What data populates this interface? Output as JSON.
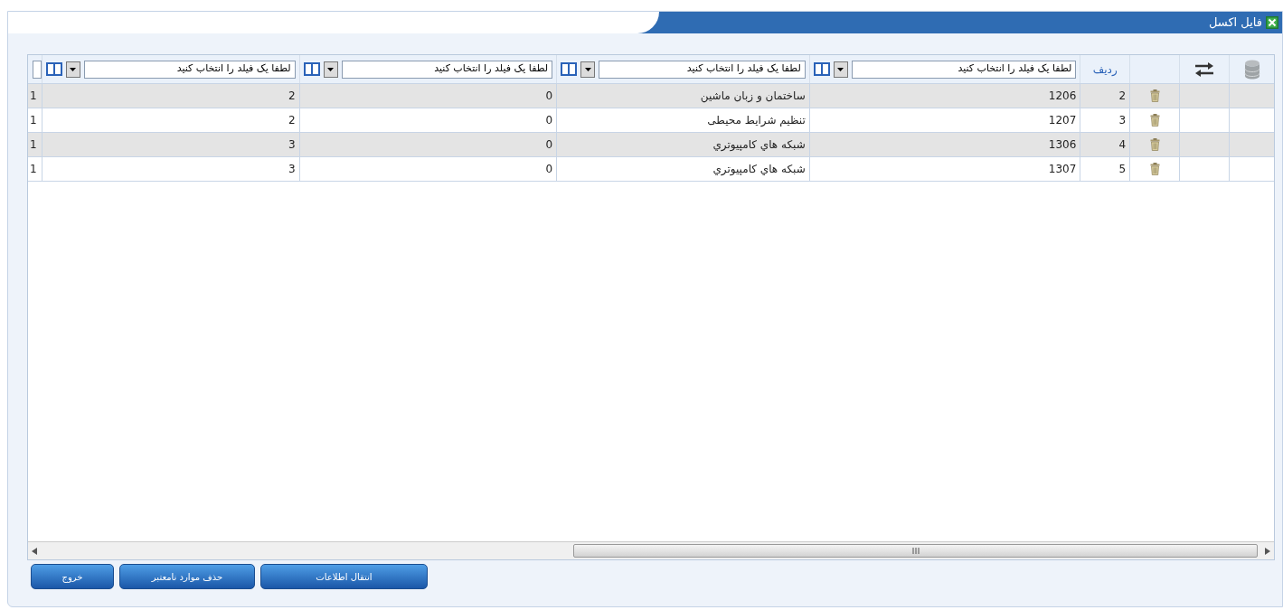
{
  "window": {
    "title": "فایل اکسل"
  },
  "table": {
    "row_header": "ردیف",
    "field_placeholders": [
      "لطفا یک فیلد را انتخاب کنید",
      "لطفا یک فیلد را انتخاب کنید",
      "لطفا یک فیلد را انتخاب کنید",
      "لطفا یک فیلد را انتخاب کنید"
    ],
    "rows": [
      {
        "row": "2",
        "cells": [
          "1206",
          "ساختمان و زبان ماشین",
          "0",
          "2",
          "1"
        ]
      },
      {
        "row": "3",
        "cells": [
          "1207",
          "تنظیم شرایط محیطی",
          "0",
          "2",
          "1"
        ]
      },
      {
        "row": "4",
        "cells": [
          "1306",
          "شبکه هاي کامپیوتري",
          "0",
          "3",
          "1"
        ]
      },
      {
        "row": "5",
        "cells": [
          "1307",
          "شبکه هاي کامپیوتري",
          "0",
          "3",
          "1"
        ]
      }
    ]
  },
  "buttons": [
    "انتقال اطلاعات",
    "حذف موارد نامعتبر",
    "خروج"
  ]
}
